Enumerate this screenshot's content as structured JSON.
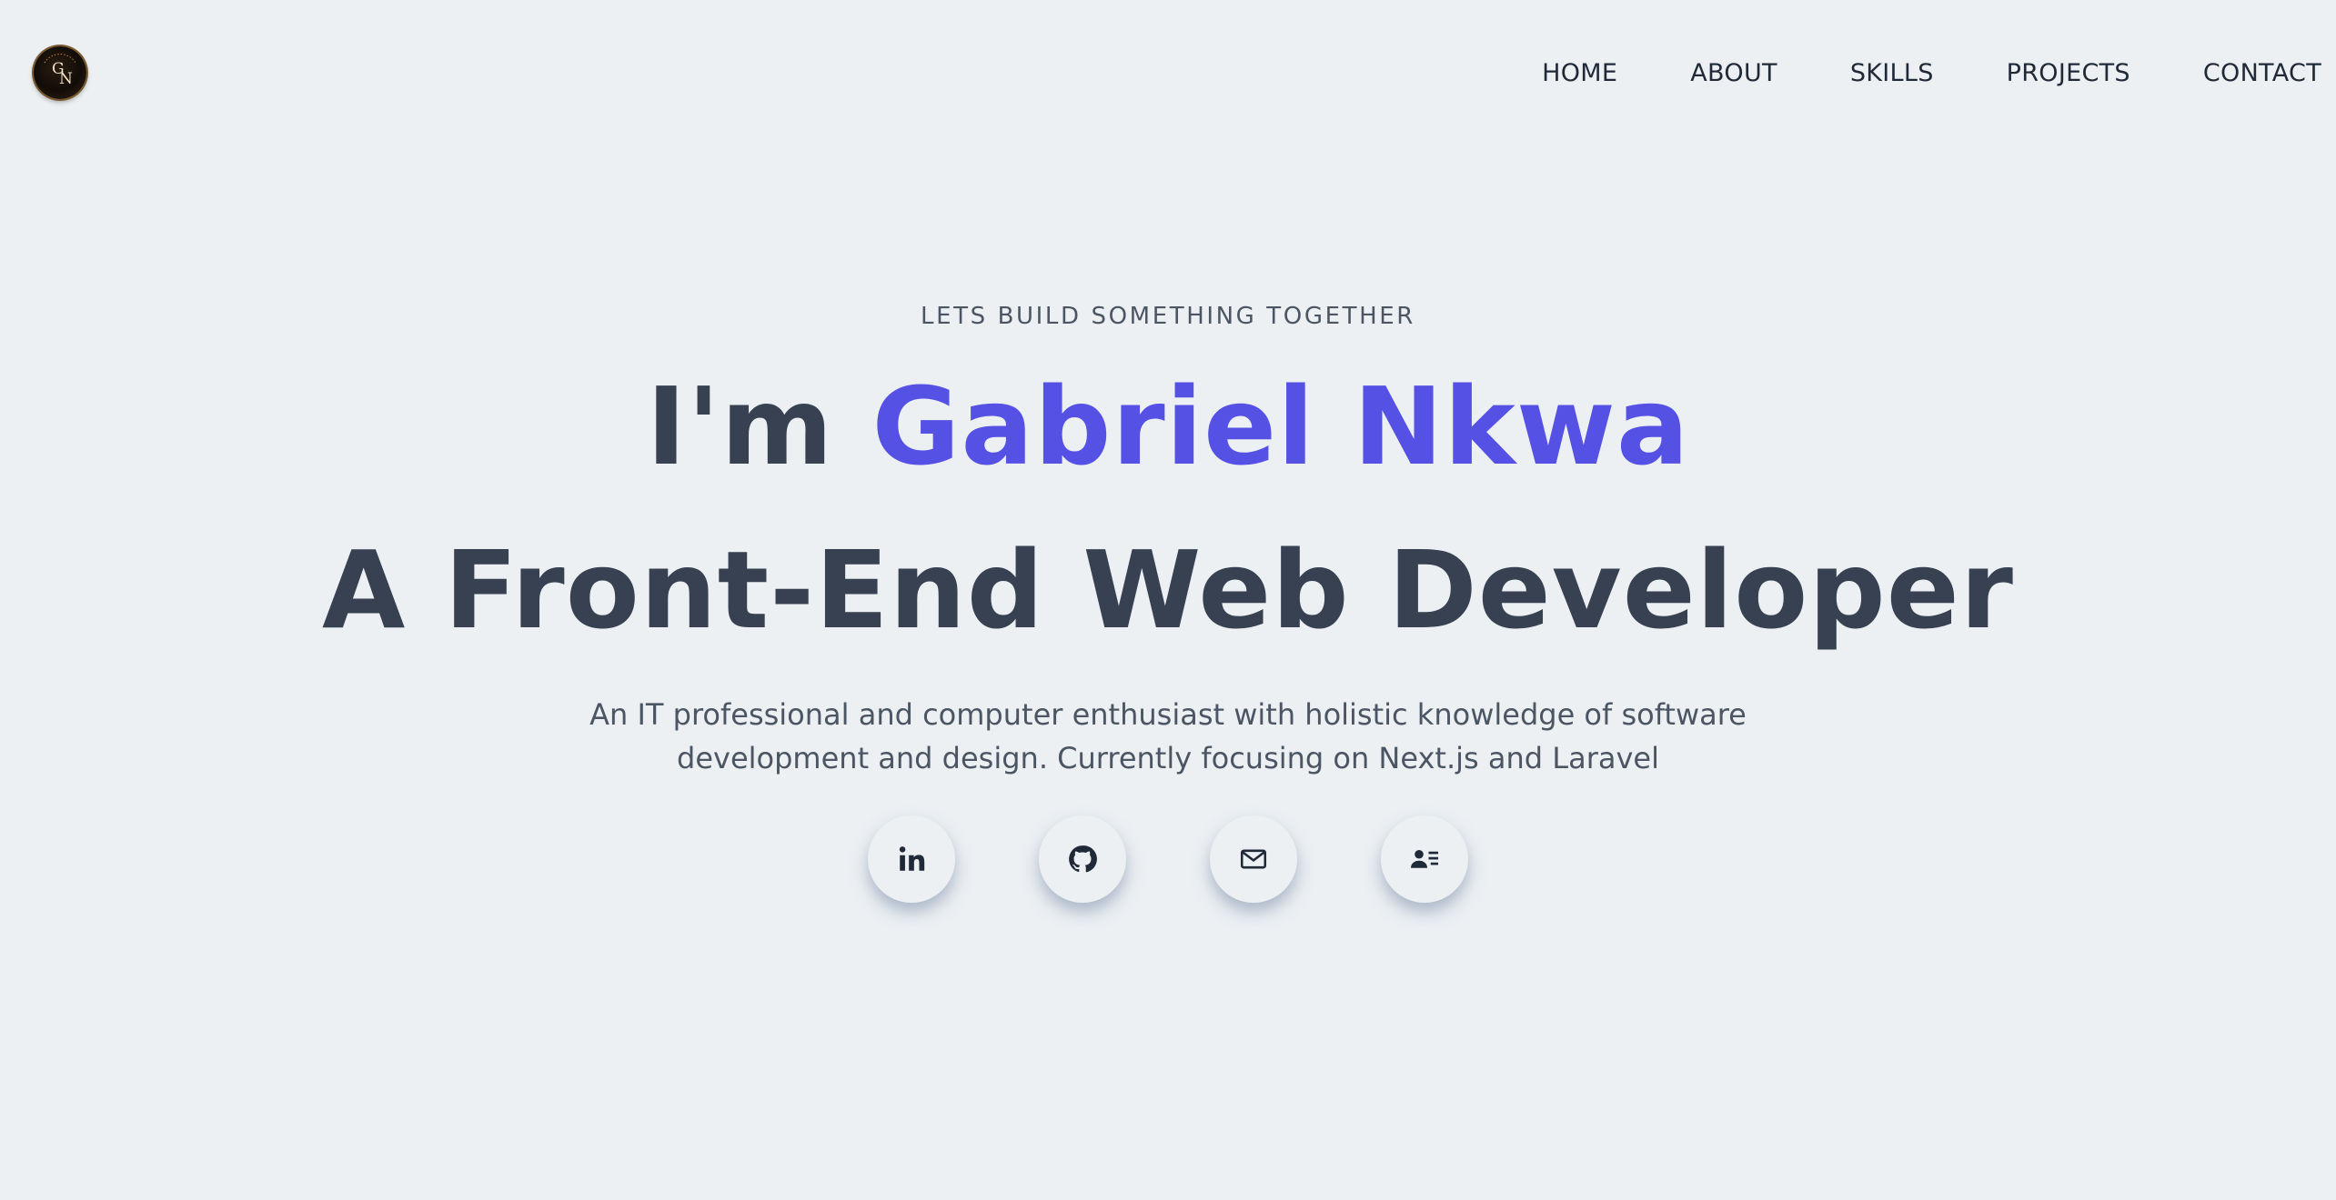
{
  "header": {
    "logo_text": "GN",
    "nav": [
      "HOME",
      "ABOUT",
      "SKILLS",
      "PROJECTS",
      "CONTACT"
    ]
  },
  "hero": {
    "tagline": "LETS BUILD SOMETHING TOGETHER",
    "greeting": "I'm",
    "name": "Gabriel Nkwa",
    "role": "A Front-End Web Developer",
    "description": "An IT professional and computer enthusiast with holistic knowledge of software development and design. Currently focusing on Next.js and Laravel"
  },
  "socials": [
    {
      "icon": "linkedin-icon"
    },
    {
      "icon": "github-icon"
    },
    {
      "icon": "mail-icon"
    },
    {
      "icon": "contact-card-icon"
    }
  ],
  "colors": {
    "background": "#ecf0f3",
    "text": "#374151",
    "accent": "#5651e5",
    "muted": "#4b5563"
  }
}
